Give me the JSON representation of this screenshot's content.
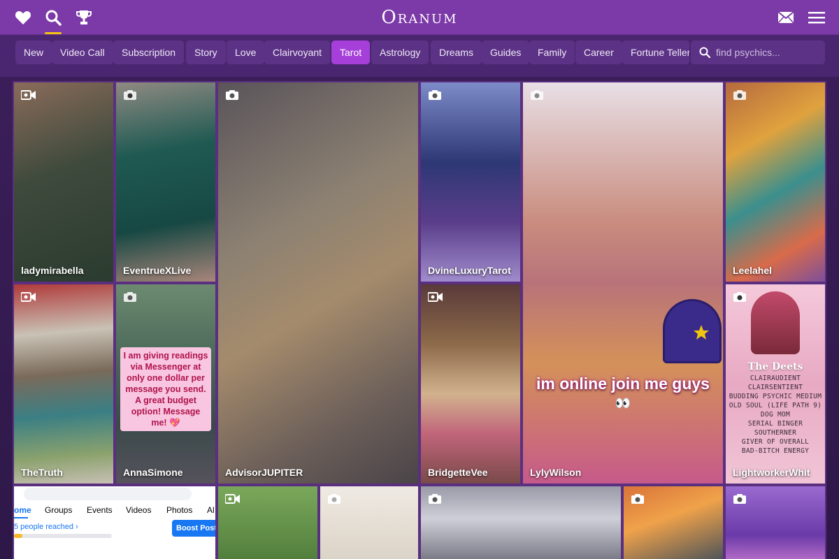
{
  "header": {
    "logo_text": "Oranum",
    "icons": [
      "heart-icon",
      "search-icon",
      "trophy-icon",
      "mail-icon",
      "menu-icon"
    ]
  },
  "categories": [
    {
      "label": "New",
      "active": false
    },
    {
      "label": "Video Call",
      "active": false
    },
    {
      "label": "Subscription",
      "active": false
    },
    {
      "label": "Story",
      "active": false
    },
    {
      "label": "Love",
      "active": false
    },
    {
      "label": "Clairvoyant",
      "active": false
    },
    {
      "label": "Tarot",
      "active": true
    },
    {
      "label": "Astrology",
      "active": false
    },
    {
      "label": "Dreams",
      "active": false
    },
    {
      "label": "Guides",
      "active": false
    },
    {
      "label": "Family",
      "active": false
    },
    {
      "label": "Career",
      "active": false
    },
    {
      "label": "Fortune Teller",
      "active": false
    }
  ],
  "search": {
    "placeholder": "find psychics..."
  },
  "colors": {
    "accent": "#a63fd9",
    "header": "#7c3aa8",
    "background": "#3d1f5c",
    "underline": "#f1c40f"
  },
  "psychics": [
    {
      "name": "ladymirabella"
    },
    {
      "name": "EventrueXLive"
    },
    {
      "name": "AdvisorJUPITER"
    },
    {
      "name": "DvineLuxuryTarot"
    },
    {
      "name": "LylyWilson"
    },
    {
      "name": "Leelahel"
    },
    {
      "name": "TheTruth"
    },
    {
      "name": "AnnaSimone"
    },
    {
      "name": "BridgetteVee"
    },
    {
      "name": "LightworkerWhit"
    }
  ],
  "annasimone_card": "I am giving readings via Messenger at only one dollar per message you send. A great budget option! Message me! 💖",
  "lylywilson_caption": "im online join me guys",
  "lylywilson_emoji": "👀",
  "lightworker_deets": {
    "title": "The Deets",
    "lines": [
      "CLAIRAUDIENT",
      "CLAIRSENTIENT",
      "BUDDING PSYCHIC MEDIUM",
      "OLD SOUL (LIFE PATH 9)",
      "DOG MOM",
      "SERIAL BINGER",
      "SOUTHERNER",
      "GIVER OF OVERALL",
      "BAD-BITCH ENERGY"
    ]
  },
  "fb_mock": {
    "tabs": [
      "ome",
      "Groups",
      "Events",
      "Videos",
      "Photos",
      "Al"
    ],
    "reach": "5 people reached ›",
    "boost": "Boost Post"
  }
}
